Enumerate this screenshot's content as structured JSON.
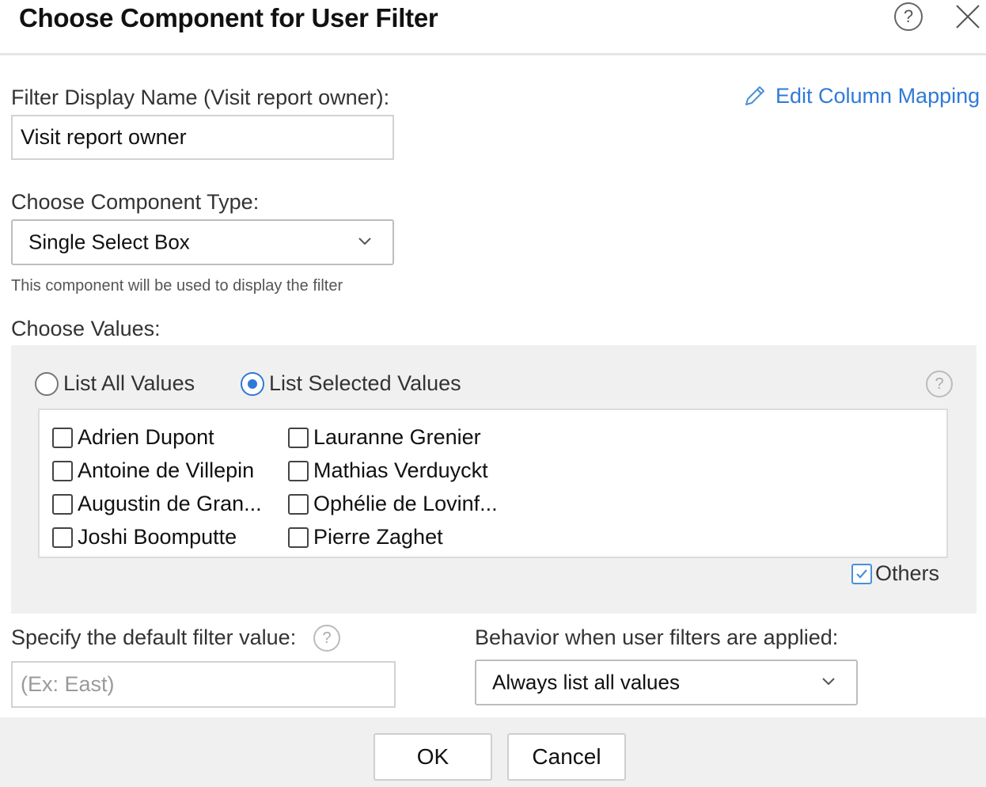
{
  "dialog": {
    "title": "Choose Component for User Filter",
    "help_icon": "help-circle-icon",
    "close_icon": "close-icon"
  },
  "display_name": {
    "label": "Filter Display Name (Visit report owner):",
    "value": "Visit report owner"
  },
  "edit_mapping": {
    "icon": "pencil-icon",
    "label": "Edit Column Mapping"
  },
  "component_type": {
    "label": "Choose Component Type:",
    "selected": "Single Select Box",
    "hint": "This component will be used to display the filter"
  },
  "values": {
    "label": "Choose Values:",
    "radio_all": "List All Values",
    "radio_selected": "List Selected Values",
    "selected_mode": "List Selected Values",
    "column1": [
      {
        "name": "Adrien Dupont",
        "checked": false
      },
      {
        "name": "Antoine de Villepin",
        "checked": false
      },
      {
        "name": "Augustin de Gran...",
        "checked": false
      },
      {
        "name": "Joshi Boomputte",
        "checked": false
      }
    ],
    "column2": [
      {
        "name": "Lauranne Grenier",
        "checked": false
      },
      {
        "name": "Mathias Verduyckt",
        "checked": false
      },
      {
        "name": "Ophélie de Lovinf...",
        "checked": false
      },
      {
        "name": "Pierre Zaghet",
        "checked": false
      }
    ],
    "others_label": "Others",
    "others_checked": true
  },
  "default_value": {
    "label": "Specify the default filter value:",
    "placeholder": "(Ex: East)",
    "value": ""
  },
  "behavior": {
    "label": "Behavior when user filters are applied:",
    "selected": "Always list all values"
  },
  "footer": {
    "ok_label": "OK",
    "cancel_label": "Cancel"
  },
  "colors": {
    "accent": "#2f7ad8",
    "panel_bg": "#f0f0f0"
  }
}
